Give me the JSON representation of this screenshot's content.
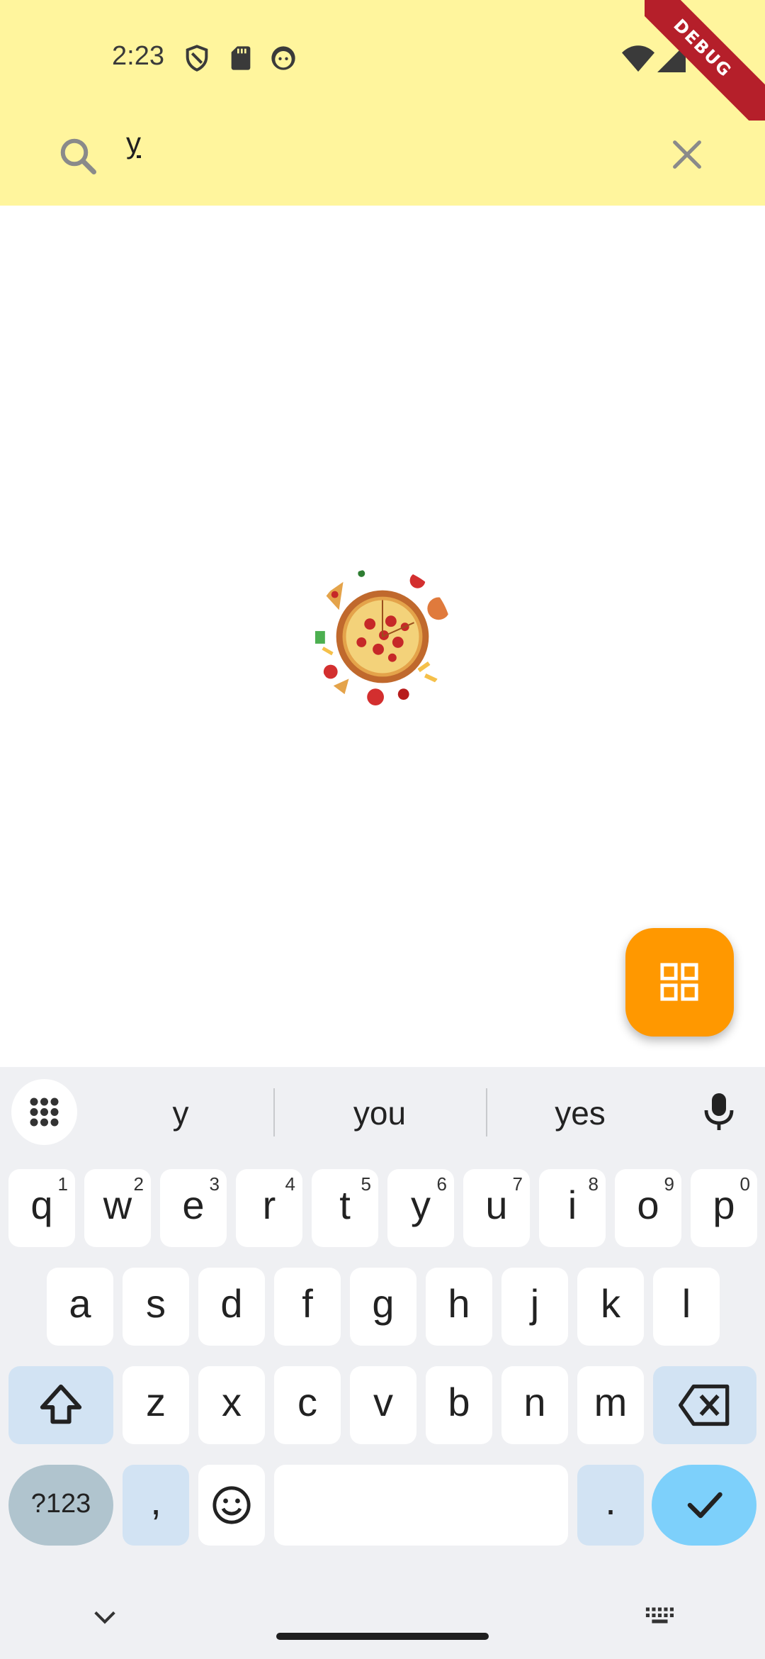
{
  "status_bar": {
    "time": "2:23",
    "icons": [
      "shield-icon",
      "sd-card-icon",
      "face-icon",
      "wifi-icon",
      "signal-icon"
    ],
    "debug_label": "DEBUG"
  },
  "search": {
    "value": "y",
    "search_icon": "search-icon",
    "clear_icon": "close-icon"
  },
  "content": {
    "image": "pizza-image",
    "fab_icon": "grid-view-icon"
  },
  "colors": {
    "appbar": "#fff59d",
    "fab": "#ff9800",
    "debug_banner": "#b51f2a",
    "keyboard_bg": "#eff0f3",
    "function_key": "#d2e3f3",
    "enter_key": "#7dd0fb"
  },
  "keyboard": {
    "suggestions": [
      "y",
      "you",
      "yes"
    ],
    "row1": [
      {
        "label": "q",
        "hint": "1"
      },
      {
        "label": "w",
        "hint": "2"
      },
      {
        "label": "e",
        "hint": "3"
      },
      {
        "label": "r",
        "hint": "4"
      },
      {
        "label": "t",
        "hint": "5"
      },
      {
        "label": "y",
        "hint": "6"
      },
      {
        "label": "u",
        "hint": "7"
      },
      {
        "label": "i",
        "hint": "8"
      },
      {
        "label": "o",
        "hint": "9"
      },
      {
        "label": "p",
        "hint": "0"
      }
    ],
    "row2": [
      "a",
      "s",
      "d",
      "f",
      "g",
      "h",
      "j",
      "k",
      "l"
    ],
    "row3": [
      "z",
      "x",
      "c",
      "v",
      "b",
      "n",
      "m"
    ],
    "symbols_label": "?123",
    "comma_label": ",",
    "period_label": "."
  }
}
